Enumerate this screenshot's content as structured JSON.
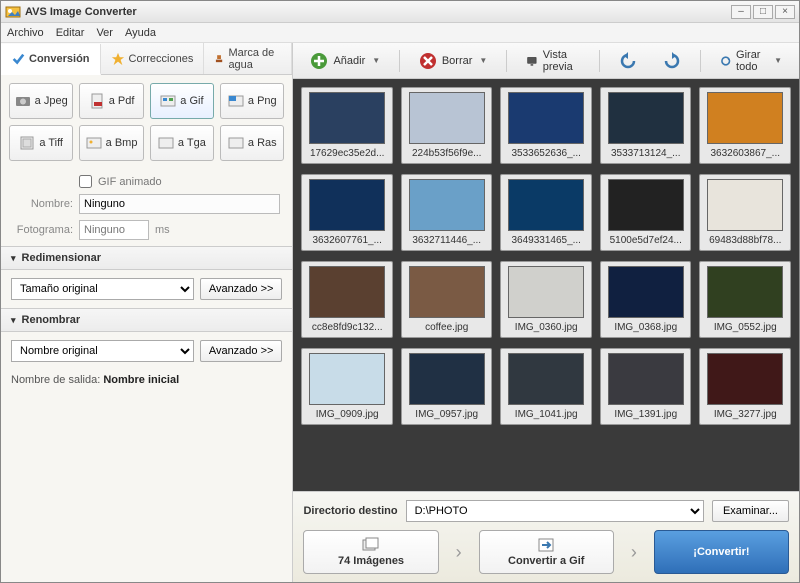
{
  "window": {
    "title": "AVS Image Converter"
  },
  "menu": {
    "file": "Archivo",
    "edit": "Editar",
    "view": "Ver",
    "help": "Ayuda"
  },
  "tabs": {
    "conversion": "Conversión",
    "corrections": "Correcciones",
    "watermark": "Marca de agua"
  },
  "formats": {
    "jpeg": "a Jpeg",
    "pdf": "a Pdf",
    "gif": "a Gif",
    "png": "a Png",
    "tiff": "a Tiff",
    "bmp": "a Bmp",
    "tga": "a Tga",
    "ras": "a Ras"
  },
  "gif": {
    "animated_label": "GIF animado",
    "name_label": "Nombre:",
    "name_value": "Ninguno",
    "frame_label": "Fotograma:",
    "frame_value": "Ninguno",
    "frame_unit": "ms"
  },
  "resize": {
    "header": "Redimensionar",
    "value": "Tamaño original",
    "advanced": "Avanzado >>"
  },
  "rename": {
    "header": "Renombrar",
    "value": "Nombre original",
    "advanced": "Avanzado >>",
    "out_label": "Nombre de salida:",
    "out_value": "Nombre inicial"
  },
  "toolbar": {
    "add": "Añadir",
    "delete": "Borrar",
    "preview": "Vista previa",
    "rotate_all": "Girar todo"
  },
  "thumbs": [
    {
      "name": "17629ec35e2d...",
      "bg": "#2a4060"
    },
    {
      "name": "224b53f56f9e...",
      "bg": "#b8c4d4"
    },
    {
      "name": "3533652636_...",
      "bg": "#1a3a70"
    },
    {
      "name": "3533713124_...",
      "bg": "#203040"
    },
    {
      "name": "3632603867_...",
      "bg": "#d08020"
    },
    {
      "name": "3632607761_...",
      "bg": "#10305a"
    },
    {
      "name": "3632711446_...",
      "bg": "#6aa0c8"
    },
    {
      "name": "3649331465_...",
      "bg": "#0a3a66"
    },
    {
      "name": "5100e5d7ef24...",
      "bg": "#222222"
    },
    {
      "name": "69483d88bf78...",
      "bg": "#e8e4dc"
    },
    {
      "name": "cc8e8fd9c132...",
      "bg": "#5a4030"
    },
    {
      "name": "coffee.jpg",
      "bg": "#7a5a44"
    },
    {
      "name": "IMG_0360.jpg",
      "bg": "#d0d0cc"
    },
    {
      "name": "IMG_0368.jpg",
      "bg": "#102040"
    },
    {
      "name": "IMG_0552.jpg",
      "bg": "#304020"
    },
    {
      "name": "IMG_0909.jpg",
      "bg": "#c8dce8"
    },
    {
      "name": "IMG_0957.jpg",
      "bg": "#203044"
    },
    {
      "name": "IMG_1041.jpg",
      "bg": "#303840"
    },
    {
      "name": "IMG_1391.jpg",
      "bg": "#3a3a40"
    },
    {
      "name": "IMG_3277.jpg",
      "bg": "#401818"
    }
  ],
  "bottom": {
    "dest_label": "Directorio destino",
    "dest_value": "D:\\PHOTO",
    "browse": "Examinar...",
    "count": "74 Imágenes",
    "convert_to": "Convertir a Gif",
    "convert": "¡Convertir!"
  }
}
